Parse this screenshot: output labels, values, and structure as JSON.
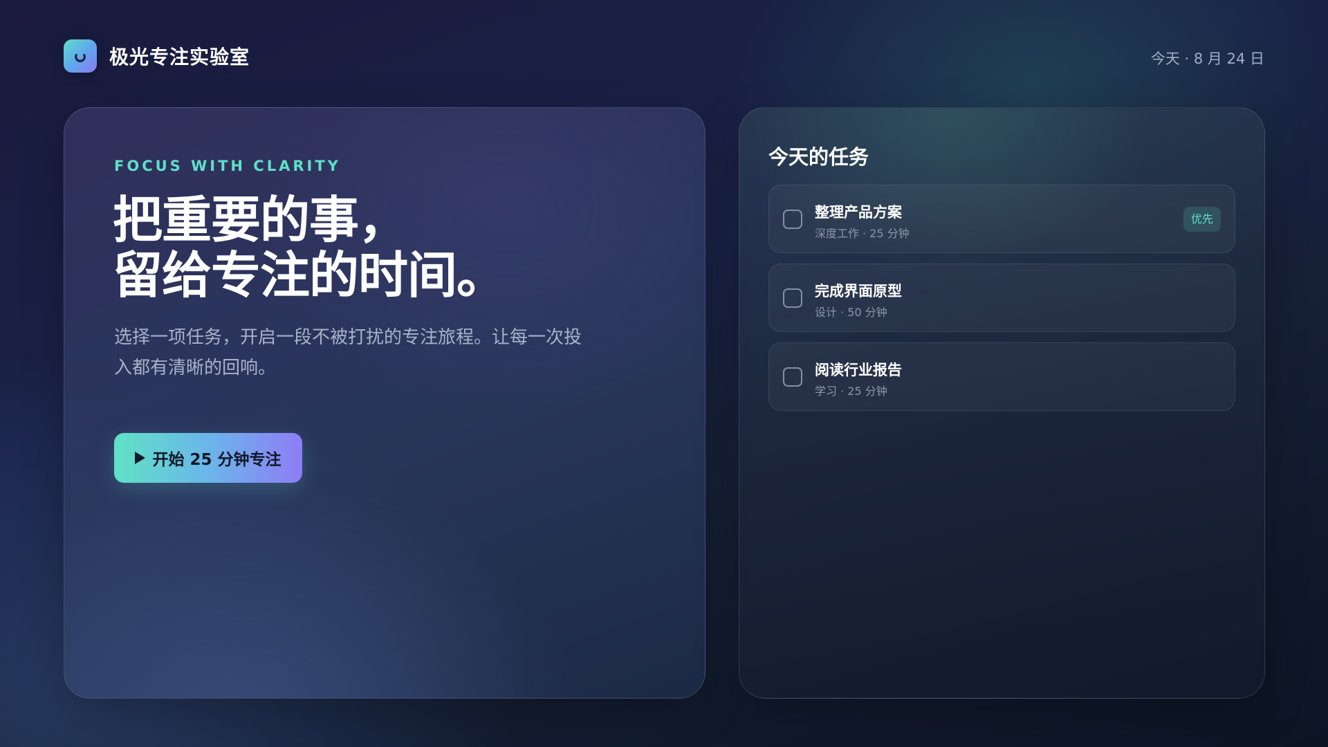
{
  "app": {
    "name": "极光专注实验室",
    "logo_icon": "power-ring-icon",
    "date_label": "今天 · 8 月 24 日"
  },
  "hero": {
    "eyebrow": "FOCUS WITH CLARITY",
    "headline_line1": "把重要的事，",
    "headline_line2": "留给专注的时间。",
    "description": "选择一项任务，开启一段不被打扰的专注旅程。让每一次投入都有清晰的回响。",
    "cta_label": "开始 25 分钟专注",
    "cta_icon": "play-icon"
  },
  "tasks": {
    "title": "今天的任务",
    "items": [
      {
        "name": "整理产品方案",
        "meta": "深度工作 · 25 分钟",
        "badge": "优先",
        "checked": false
      },
      {
        "name": "完成界面原型",
        "meta": "设计 · 50 分钟",
        "checked": false
      },
      {
        "name": "阅读行业报告",
        "meta": "学习 · 25 分钟",
        "checked": false
      }
    ]
  },
  "colors": {
    "accent": "#5fe0c7",
    "gradient_start": "#60e2c5",
    "gradient_mid": "#6ab6ea",
    "gradient_end": "#8f7cf5",
    "background": "#191a3c"
  }
}
